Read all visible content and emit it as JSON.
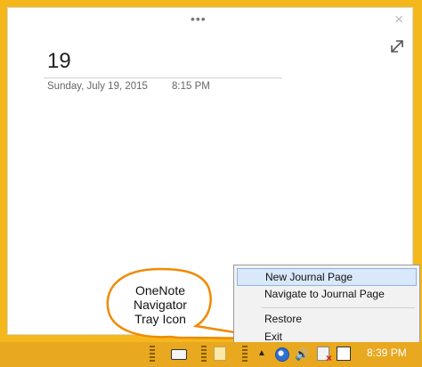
{
  "note": {
    "page_title": "19",
    "date": "Sunday, July 19, 2015",
    "time": "8:15 PM"
  },
  "window_controls": {
    "dots": "•••",
    "close": "×"
  },
  "context_menu": {
    "items": [
      {
        "label": "New Journal Page",
        "highlighted": true
      },
      {
        "label": "Navigate to Journal Page",
        "highlighted": false
      },
      {
        "label": "Restore",
        "highlighted": false
      },
      {
        "label": "Exit",
        "highlighted": false
      }
    ]
  },
  "callout": {
    "lines": [
      "OneNote",
      "Navigator",
      "Tray Icon"
    ]
  },
  "taskbar": {
    "arrow": "▲",
    "clock": "8:39 PM"
  },
  "colors": {
    "desktop": "#f4b81c",
    "taskbar": "#e8a820",
    "callout_border": "#f08a00",
    "menu_highlight": "#d9e8fb"
  }
}
